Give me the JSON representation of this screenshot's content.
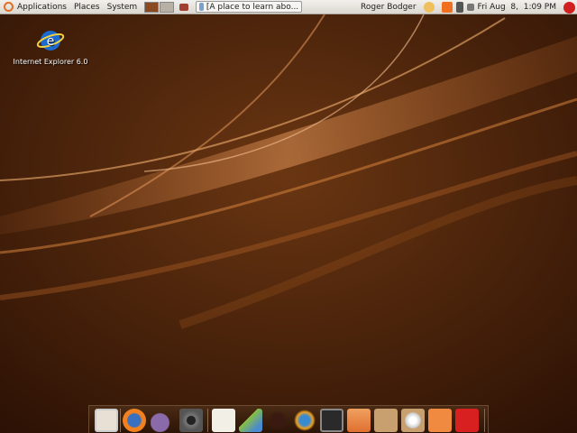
{
  "panel": {
    "menus": [
      "Applications",
      "Places",
      "System"
    ],
    "task_label": "[A place to learn abo...",
    "user": "Roger Bodger",
    "clock": "Fri Aug  8,  1:09 PM"
  },
  "desktop": {
    "icons": [
      {
        "label": "Internet Explorer 6.0"
      }
    ]
  },
  "dock": {
    "items": [
      "show-desktop",
      "firefox",
      "pidgin",
      "camera",
      "text-editor",
      "music",
      "spider",
      "owl",
      "terminal",
      "home-folder",
      "package",
      "install-disc",
      "trash",
      "power"
    ]
  },
  "colors": {
    "panel": "#e6e3dd",
    "wallpaper": "#3a1a08",
    "accent": "#e07020"
  }
}
